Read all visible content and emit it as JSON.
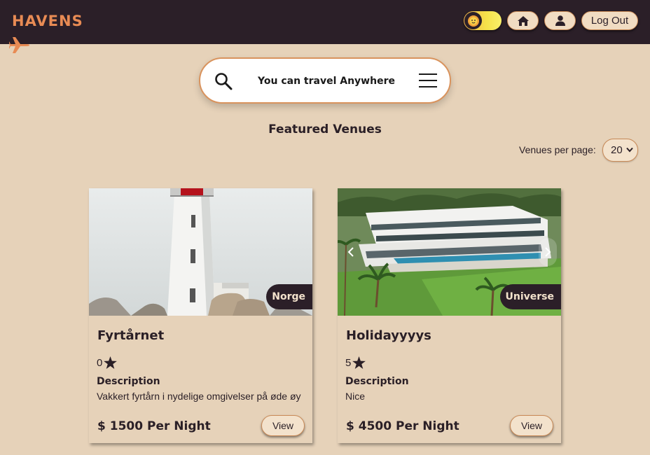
{
  "header": {
    "logo": "HAVENS",
    "logout_label": "Log Out"
  },
  "search": {
    "text": "You can travel Anywhere"
  },
  "section_title": "Featured Venues",
  "pagination": {
    "label": "Venues per page:",
    "selected": "20"
  },
  "venues": [
    {
      "name": "Fyrtårnet",
      "location": "Norge",
      "rating": "0",
      "description_label": "Description",
      "description": "Vakkert fyrtårn i nydelige omgivelser på øde øy",
      "price": "$ 1500 Per Night",
      "view_label": "View"
    },
    {
      "name": "Holidayyyys",
      "location": "Universe",
      "rating": "5",
      "description_label": "Description",
      "description": "Nice",
      "price": "$ 4500 Per Night",
      "view_label": "View"
    }
  ],
  "colors": {
    "background": "#e6d2b9",
    "header": "#2b1f28",
    "accent": "#e88b54",
    "border": "#c98a57"
  }
}
